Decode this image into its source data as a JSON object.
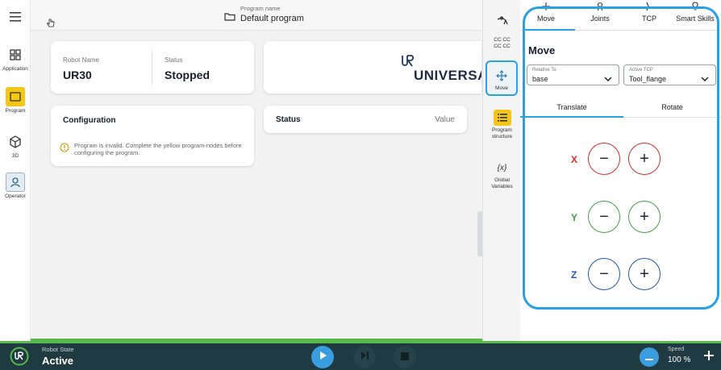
{
  "nav": {
    "items": [
      {
        "label": "Application",
        "icon": "grid-icon"
      },
      {
        "label": "Program",
        "icon": "program-icon"
      },
      {
        "label": "3D",
        "icon": "cube-icon"
      },
      {
        "label": "Operator",
        "icon": "user-icon"
      }
    ]
  },
  "header": {
    "program_label": "Program name",
    "program_name": "Default program"
  },
  "robot_card": {
    "name_label": "Robot Name",
    "name_value": "UR30",
    "status_label": "Status",
    "status_value": "Stopped"
  },
  "logo_text": "UNIVERSA",
  "config_card": {
    "title": "Configuration",
    "warning": "Program is invalid. Complete the yellow program-nodes before configuring the program."
  },
  "status_card": {
    "title": "Status",
    "value_col": "Value"
  },
  "rtool": {
    "cc_line1": "CC CC",
    "cc_line2": "CC CC",
    "move": "Move",
    "program_structure_1": "Program",
    "program_structure_2": "structure",
    "global_symbol": "{x}",
    "global_1": "Global",
    "global_2": "Variables"
  },
  "move_panel": {
    "tabs": [
      "Move",
      "Joints",
      "TCP",
      "Smart Skills"
    ],
    "title": "Move",
    "relative_label": "Relative To",
    "relative_value": "base",
    "tcp_label": "Active TCP",
    "tcp_value": "Tool_flange",
    "subtab_translate": "Translate",
    "subtab_rotate": "Rotate",
    "axes": [
      "X",
      "Y",
      "Z"
    ],
    "minus": "−",
    "plus": "+"
  },
  "bottom": {
    "state_label": "Robot State",
    "state_value": "Active",
    "speed_label": "Speed",
    "speed_value": "100 %"
  },
  "colors": {
    "accent_blue": "#2aa0e6",
    "program_yellow": "#f5c518",
    "x_red": "#d32f2f",
    "y_green": "#43a047",
    "z_blue": "#1e5aa8",
    "bottom_bg": "#1f3a40",
    "active_green": "#57b84b"
  }
}
